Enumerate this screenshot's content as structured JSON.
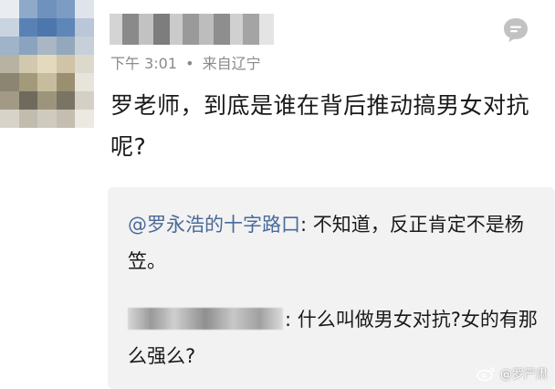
{
  "post": {
    "meta_time": "下午 3:01",
    "meta_sep": "•",
    "meta_location": "来自辽宁",
    "main_text": "罗老师，到底是谁在背后推动搞男女对抗呢?"
  },
  "quote": {
    "mention": "@罗永浩的十字路口",
    "reply_text": ": 不知道，反正肯定不是杨笠。",
    "second_text": ": 什么叫做男女对抗?女的有那么强么?"
  },
  "watermark": {
    "text": "@罗严肃"
  },
  "colors": {
    "mention": "#4a6a9a",
    "meta": "#8a8a8a",
    "quote_bg": "#f2f2f2"
  },
  "icons": {
    "reply": "comment-bubble-icon",
    "watermark": "weibo-logo-icon"
  }
}
